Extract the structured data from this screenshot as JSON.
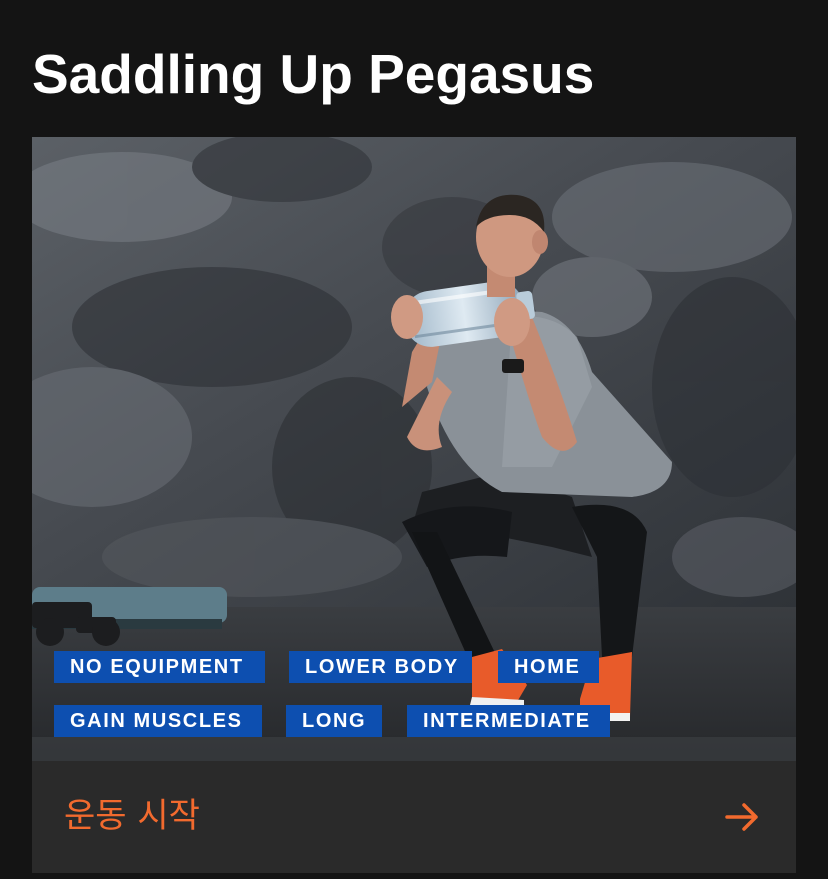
{
  "workout": {
    "title": "Saddling Up Pegasus",
    "image_alt": "Man squatting while holding a large water bottle against a concrete wall",
    "tags": [
      "NO EQUIPMENT",
      "LOWER BODY",
      "HOME",
      "GAIN MUSCLES",
      "LONG",
      "INTERMEDIATE"
    ]
  },
  "cta": {
    "label": "운동 시작",
    "icon": "arrow-right-icon"
  },
  "colors": {
    "background": "#141414",
    "card": "#2a2a2a",
    "tag": "#0d4fb0",
    "accent": "#f26a2e",
    "title": "#ffffff"
  }
}
